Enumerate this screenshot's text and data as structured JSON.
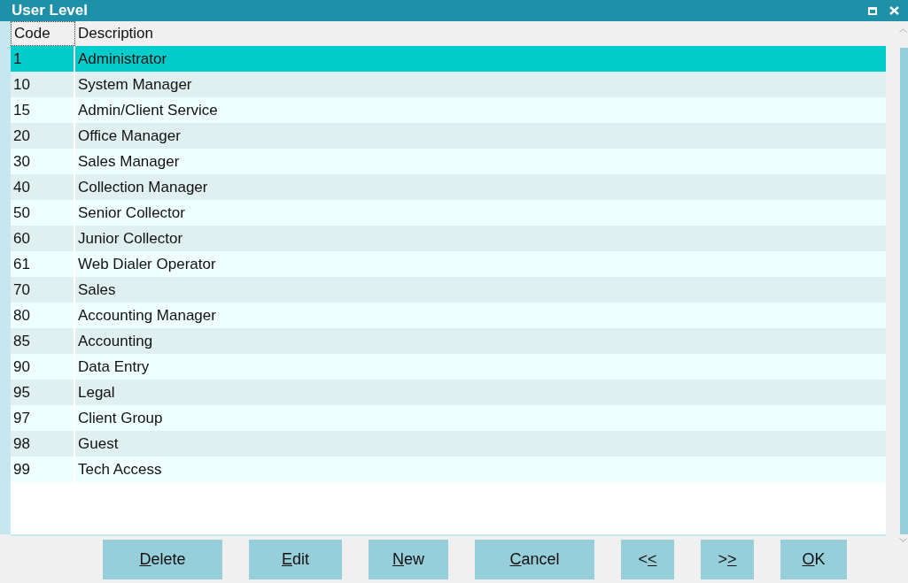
{
  "window": {
    "title": "User Level"
  },
  "table": {
    "columns": [
      "Code",
      "Description"
    ],
    "rows": [
      {
        "code": "1",
        "description": "Administrator",
        "selected": true
      },
      {
        "code": "10",
        "description": "System Manager",
        "selected": false
      },
      {
        "code": "15",
        "description": "Admin/Client Service",
        "selected": false
      },
      {
        "code": "20",
        "description": "Office Manager",
        "selected": false
      },
      {
        "code": "30",
        "description": "Sales Manager",
        "selected": false
      },
      {
        "code": "40",
        "description": "Collection Manager",
        "selected": false
      },
      {
        "code": "50",
        "description": "Senior Collector",
        "selected": false
      },
      {
        "code": "60",
        "description": "Junior Collector",
        "selected": false
      },
      {
        "code": "61",
        "description": "Web Dialer Operator",
        "selected": false
      },
      {
        "code": "70",
        "description": "Sales",
        "selected": false
      },
      {
        "code": "80",
        "description": "Accounting Manager",
        "selected": false
      },
      {
        "code": "85",
        "description": "Accounting",
        "selected": false
      },
      {
        "code": "90",
        "description": "Data Entry",
        "selected": false
      },
      {
        "code": "95",
        "description": "Legal",
        "selected": false
      },
      {
        "code": "97",
        "description": "Client Group",
        "selected": false
      },
      {
        "code": "98",
        "description": "Guest",
        "selected": false
      },
      {
        "code": "99",
        "description": "Tech Access",
        "selected": false
      }
    ]
  },
  "buttons": [
    {
      "access_key": "D",
      "after": "elete"
    },
    {
      "access_key": "E",
      "after": "dit"
    },
    {
      "access_key": "N",
      "after": "ew"
    },
    {
      "access_key": "C",
      "after": "ancel"
    },
    {
      "before": "<",
      "access_key": "<"
    },
    {
      "before": ">",
      "access_key": ">"
    },
    {
      "access_key": "O",
      "after": "K"
    }
  ]
}
